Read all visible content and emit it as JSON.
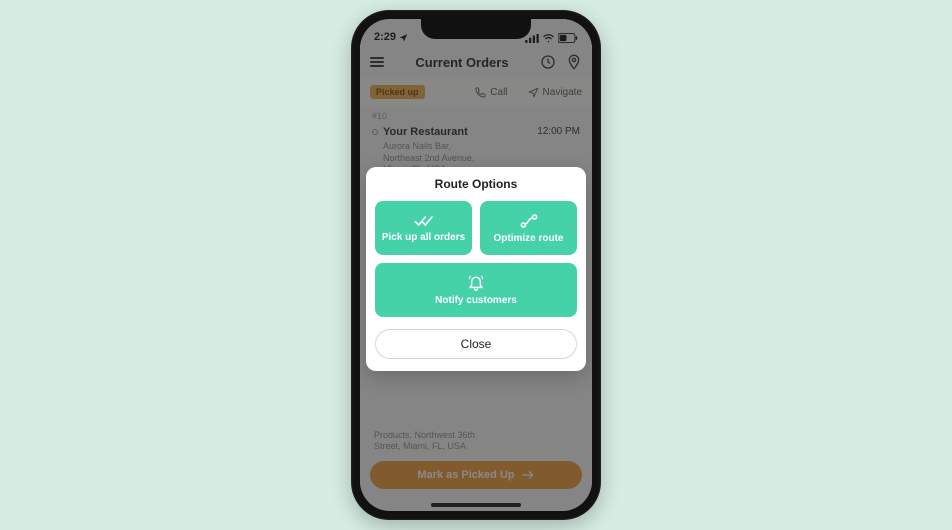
{
  "status": {
    "time": "2:29"
  },
  "header": {
    "title": "Current Orders"
  },
  "actions": {
    "badge": "Picked up",
    "call": "Call",
    "navigate": "Navigate"
  },
  "order": {
    "id": "#10",
    "name": "Your Restaurant",
    "time": "12:00 PM",
    "address_line1": "Aurora Nails Bar,",
    "address_line2": "Northeast 2nd Avenue,",
    "address_line3": "Miami, FL, USA"
  },
  "lower": {
    "address_line1": "Products, Northwest 36th",
    "address_line2": "Street, Miami, FL, USA",
    "primary_button": "Mark as Picked Up"
  },
  "modal": {
    "title": "Route Options",
    "pickup": "Pick up all orders",
    "optimize": "Optimize route",
    "notify": "Notify customers",
    "close": "Close"
  }
}
